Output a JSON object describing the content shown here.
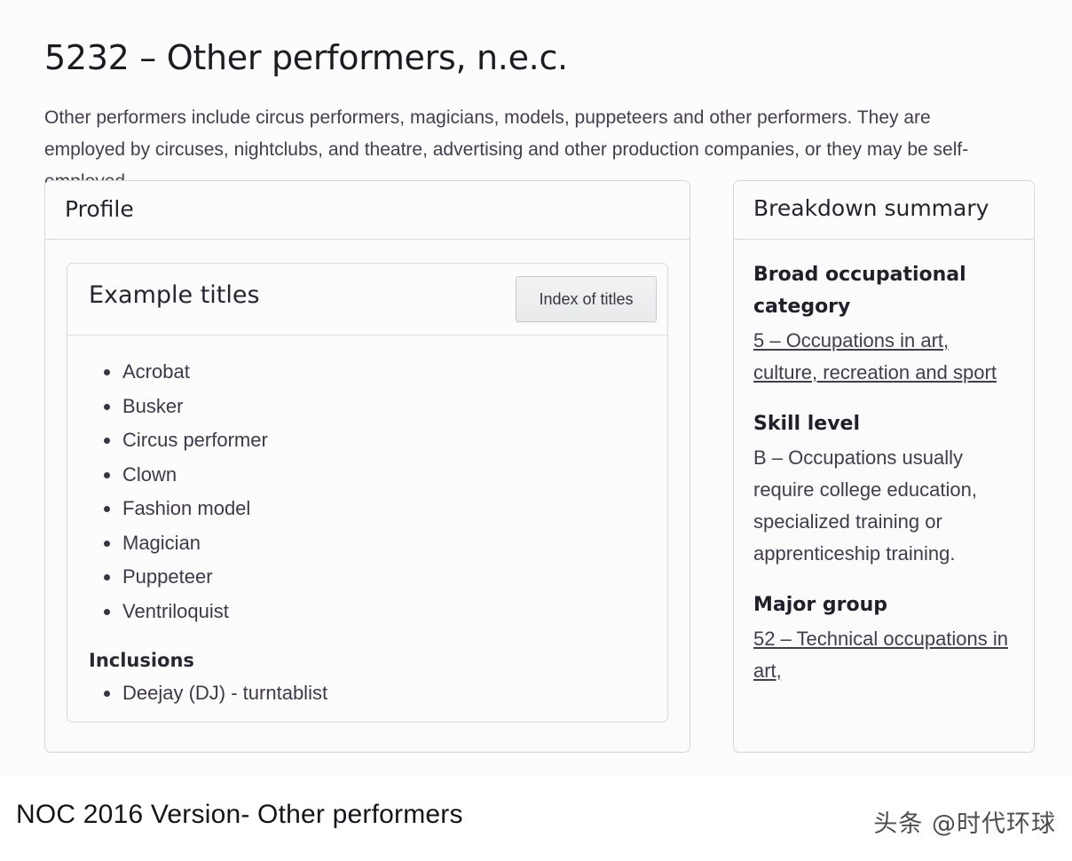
{
  "header": {
    "title": "5232 – Other performers, n.e.c.",
    "description": "Other performers include circus performers, magicians, models, puppeteers and other performers. They are employed by circuses, nightclubs, and theatre, advertising and other production companies, or they may be self-employed."
  },
  "profile": {
    "panel_title": "Profile",
    "example_titles": {
      "card_title": "Example titles",
      "index_button_label": "Index of titles",
      "items": [
        "Acrobat",
        "Busker",
        "Circus performer",
        "Clown",
        "Fashion model",
        "Magician",
        "Puppeteer",
        "Ventriloquist"
      ],
      "inclusions_heading": "Inclusions",
      "inclusions": [
        "Deejay (DJ) - turntablist"
      ]
    }
  },
  "breakdown": {
    "panel_title": "Breakdown summary",
    "broad_category_label": "Broad occupational category",
    "broad_category_link": "5 – Occupations in art, culture, recreation and sport",
    "skill_level_label": "Skill level",
    "skill_level_value": "B – Occupations usually require college education, specialized training or apprenticeship training.",
    "major_group_label": "Major group",
    "major_group_link": "52 – Technical occupations in art,"
  },
  "footer": {
    "caption": "NOC 2016 Version- Other performers",
    "watermark": "头条 @时代环球"
  },
  "colors": {
    "page_background": "#fcfcfd",
    "panel_background": "#fbfbfc",
    "panel_border": "#d4d6da",
    "text": "#3b3444",
    "heading": "#1d1b22",
    "button_face": "#eeeff0"
  }
}
